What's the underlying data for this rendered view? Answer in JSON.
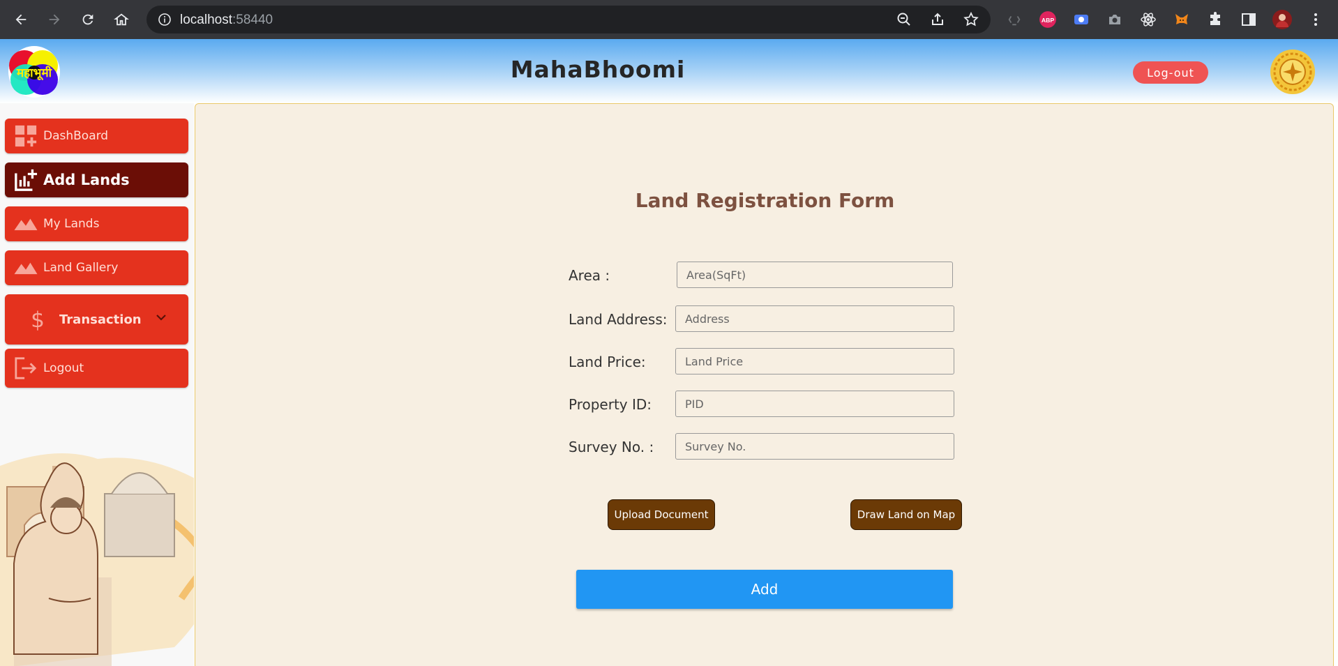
{
  "browser": {
    "url_host": "localhost",
    "url_port": ":58440"
  },
  "header": {
    "title": "MahaBhoomi",
    "logout_label": "Log-out",
    "logo_text": "महाभूमी"
  },
  "sidebar": {
    "items": [
      {
        "label": "DashBoard",
        "icon": "dashboard-icon"
      },
      {
        "label": "Add Lands",
        "icon": "add-chart-icon",
        "active": true
      },
      {
        "label": "My Lands",
        "icon": "landscape-icon"
      },
      {
        "label": "Land Gallery",
        "icon": "landscape-icon"
      },
      {
        "label": "Transaction",
        "icon": "dollar-icon",
        "expandable": true
      },
      {
        "label": "Logout",
        "icon": "logout-icon"
      }
    ]
  },
  "form": {
    "title": "Land Registration Form",
    "fields": [
      {
        "label": "Area :",
        "placeholder": "Area(SqFt)",
        "value": ""
      },
      {
        "label": "Land Address:",
        "placeholder": "Address",
        "value": ""
      },
      {
        "label": "Land Price:",
        "placeholder": "Land Price",
        "value": ""
      },
      {
        "label": "Property ID:",
        "placeholder": "PID",
        "value": ""
      },
      {
        "label": "Survey No. :",
        "placeholder": "Survey No.",
        "value": ""
      }
    ],
    "upload_label": "Upload Document",
    "draw_label": "Draw Land on Map",
    "add_label": "Add"
  },
  "colors": {
    "sidebar_item": "#e4321e",
    "sidebar_active": "#6b0e06",
    "form_background": "#f7efe2",
    "action_button": "#6b3a06",
    "primary_button": "#2196f3",
    "logout_button": "#ef5353"
  }
}
